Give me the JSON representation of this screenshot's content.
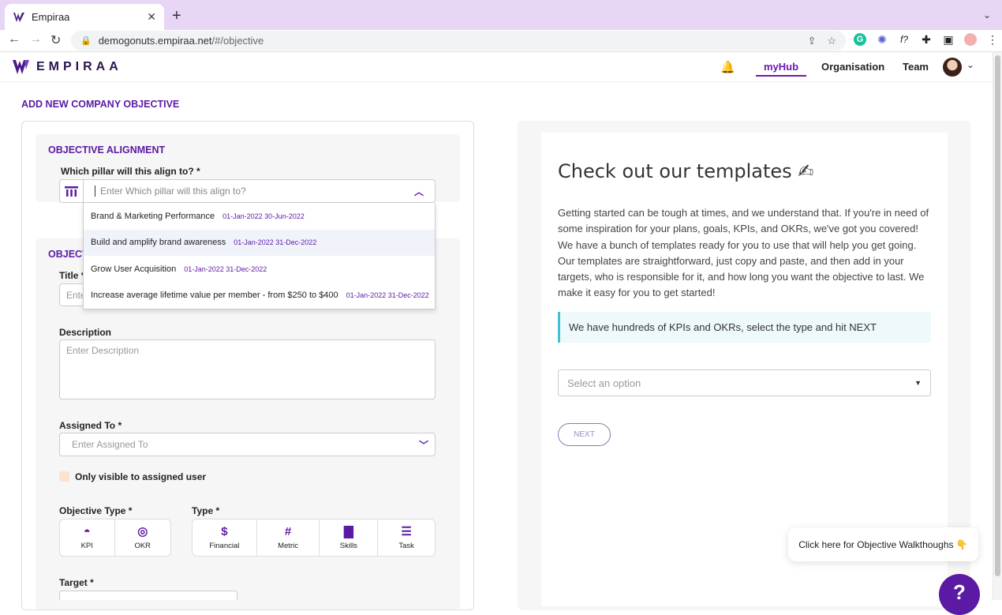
{
  "browser": {
    "tab_title": "Empiraa",
    "tab_close": "✕",
    "new_tab": "+",
    "url_host": "demogonuts.empiraa.net",
    "url_path": "/#/objective",
    "ext_g": "G",
    "ext_fx": "f?"
  },
  "header": {
    "logo_text": "EMPIRAA",
    "nav": {
      "myhub": "myHub",
      "organisation": "Organisation",
      "team": "Team"
    }
  },
  "page": {
    "title": "ADD NEW COMPANY OBJECTIVE"
  },
  "form": {
    "alignment_heading": "OBJECTIVE ALIGNMENT",
    "pillar_label": "Which pillar will this align to? *",
    "pillar_placeholder": "Enter Which pillar will this align to?",
    "pillar_options": [
      {
        "name": "Brand & Marketing Performance",
        "dates": "01-Jan-2022 30-Jun-2022"
      },
      {
        "name": "Build and amplify brand awareness",
        "dates": "01-Jan-2022 31-Dec-2022"
      },
      {
        "name": "Grow User Acquisition",
        "dates": "01-Jan-2022 31-Dec-2022"
      },
      {
        "name": "Increase average lifetime value per member - from $250 to $400",
        "dates": "01-Jan-2022 31-Dec-2022"
      }
    ],
    "details_heading_partial": "OBJECT",
    "title_label_partial": "Title *",
    "title_placeholder_partial": "Ente",
    "description_label": "Description",
    "description_placeholder": "Enter Description",
    "assigned_label": "Assigned To *",
    "assigned_placeholder": "Enter Assigned To",
    "only_visible_label": "Only visible to assigned user",
    "objective_type_label": "Objective Type *",
    "objective_types": [
      {
        "label": "KPI",
        "icon": "gauge-icon"
      },
      {
        "label": "OKR",
        "icon": "target-icon"
      }
    ],
    "type_label": "Type *",
    "types": [
      {
        "label": "Financial",
        "icon": "dollar-icon"
      },
      {
        "label": "Metric",
        "icon": "hash-icon"
      },
      {
        "label": "Skills",
        "icon": "box-icon"
      },
      {
        "label": "Task",
        "icon": "list-icon"
      }
    ],
    "target_label": "Target *"
  },
  "templates": {
    "title": "Check out our templates ✍",
    "body": "Getting started can be tough at times, and we understand that. If you're in need of some inspiration for your plans, goals, KPIs, and OKRs, we've got you covered! We have a bunch of templates ready for you to use that will help you get going. Our templates are straightforward, just copy and paste, and then add in your targets, who is responsible for it, and how long you want the objective to last. We make it easy for you to get started!",
    "callout": "We have hundreds of KPIs and OKRs, select the type and hit NEXT",
    "select_placeholder": "Select an option",
    "next_label": "NEXT"
  },
  "walkthrough": {
    "label": "Click here for Objective Walkthoughs 👇"
  },
  "help": {
    "label": "?"
  },
  "colors": {
    "brand_purple": "#5b1aa3",
    "accent_teal": "#3fc1d4",
    "tabbar": "#e7d6f6"
  }
}
